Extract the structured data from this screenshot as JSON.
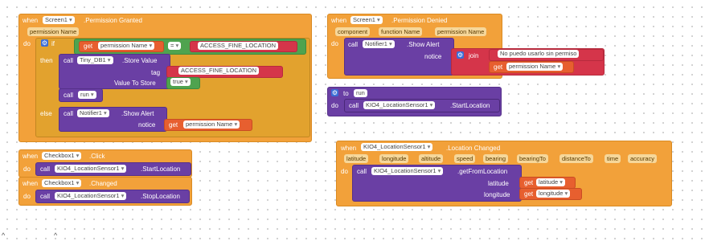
{
  "event_permission_granted": {
    "when": "when",
    "component": "Screen1",
    "event": ".Permission Granted",
    "param": "permission Name",
    "do": "do",
    "if": "if",
    "then": "then",
    "else": "else",
    "get": "get",
    "get_var": "permission Name",
    "eq": "=",
    "const_str": "ACCESS_FINE_LOCATION",
    "call": "call",
    "tinydb": "Tiny_DB1",
    "store_value": ".Store Value",
    "tag": "tag",
    "tag_value": "ACCESS_FINE_LOCATION",
    "value_to_store": "Value To Store",
    "true": "true",
    "run": "run",
    "notifier": "Notifier1",
    "show_alert": ".Show Alert",
    "notice": "notice",
    "else_get_var": "permission Name"
  },
  "event_permission_denied": {
    "when": "when",
    "component": "Screen1",
    "event": ".Permission Denied",
    "params": [
      "component",
      "function Name",
      "permission Name"
    ],
    "do": "do",
    "call": "call",
    "notifier": "Notifier1",
    "show_alert": ".Show Alert",
    "notice": "notice",
    "join": "join",
    "join_str": "No puedo usarlo sin permiso",
    "get": "get",
    "get_var": "permission Name"
  },
  "proc_run": {
    "to": "to",
    "name": "run",
    "do": "do",
    "call": "call",
    "sensor": "KIO4_LocationSensor1",
    "method": ".StartLocation"
  },
  "event_checkbox_click": {
    "when": "when",
    "component": "Checkbox1",
    "event": ".Click",
    "do": "do",
    "call": "call",
    "sensor": "KIO4_LocationSensor1",
    "method": ".StartLocation"
  },
  "event_checkbox_changed": {
    "when": "when",
    "component": "Checkbox1",
    "event": ".Changed",
    "do": "do",
    "call": "call",
    "sensor": "KIO4_LocationSensor1",
    "method": ".StopLocation"
  },
  "event_location_changed": {
    "when": "when",
    "component": "KIO4_LocationSensor1",
    "event": ".Location Changed",
    "params": [
      "latitude",
      "longitude",
      "altitude",
      "speed",
      "bearing",
      "bearingTo",
      "distanceTo",
      "time",
      "accuracy"
    ],
    "do": "do",
    "call": "call",
    "sensor": "KIO4_LocationSensor1",
    "method": ".getFromLocation",
    "arg1": "latitude",
    "arg2": "longitude",
    "get": "get",
    "get1": "latitude",
    "get2": "longitude"
  },
  "colors": {
    "event": "#f2a13a",
    "procedure": "#6a3fa4",
    "control": "#e2a22e",
    "logic": "#4fa34f",
    "text": "#d5354a",
    "variable": "#e75f2f"
  }
}
